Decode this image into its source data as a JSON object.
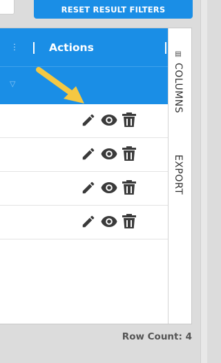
{
  "toolbar": {
    "reset_filters_label": "RESET RESULT FILTERS"
  },
  "grid": {
    "columns": [
      {
        "label": "Actions"
      }
    ],
    "rows": [
      {
        "actions": [
          "edit",
          "view",
          "delete"
        ]
      },
      {
        "actions": [
          "edit",
          "view",
          "delete"
        ]
      },
      {
        "actions": [
          "edit",
          "view",
          "delete"
        ]
      },
      {
        "actions": [
          "edit",
          "view",
          "delete"
        ]
      }
    ],
    "side_panel": {
      "columns_label": "COLUMNS",
      "export_label": "EXPORT"
    }
  },
  "footer": {
    "row_count_label": "Row Count: 4"
  },
  "colors": {
    "header_blue": "#1a8ee6",
    "icon_gray": "#3a3a3a",
    "annotation_arrow": "#f5c842"
  },
  "icons": [
    "pencil-icon",
    "eye-icon",
    "trash-icon",
    "filter-icon",
    "column-menu-icon",
    "columns-icon"
  ]
}
